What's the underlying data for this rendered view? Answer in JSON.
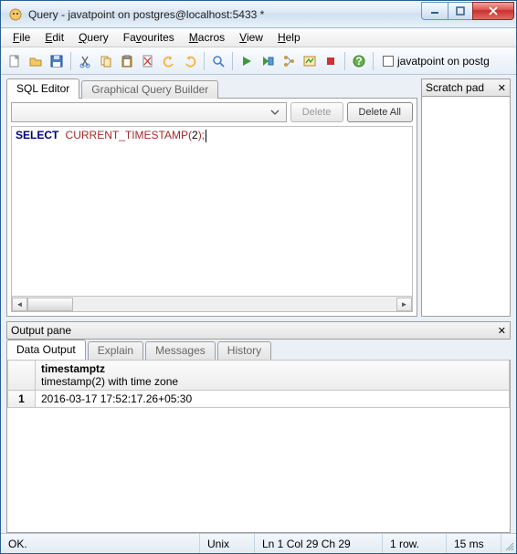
{
  "title": "Query - javatpoint on postgres@localhost:5433 *",
  "menubar": [
    "File",
    "Edit",
    "Query",
    "Favourites",
    "Macros",
    "View",
    "Help"
  ],
  "toolbar_label": "javatpoint on postg",
  "tabs": {
    "sql_editor": "SQL Editor",
    "graphical": "Graphical Query Builder"
  },
  "buttons": {
    "delete": "Delete",
    "delete_all": "Delete All"
  },
  "sql": {
    "kw": "SELECT",
    "fn": "CURRENT_TIMESTAMP",
    "open": "(",
    "arg": "2",
    "close": ");"
  },
  "scratch": {
    "title": "Scratch pad"
  },
  "output": {
    "title": "Output pane",
    "tabs": [
      "Data Output",
      "Explain",
      "Messages",
      "History"
    ],
    "col_name": "timestamptz",
    "col_type": "timestamp(2) with time zone",
    "row_num": "1",
    "cell": "2016-03-17 17:52:17.26+05:30"
  },
  "status": {
    "ok": "OK.",
    "enc": "Unix",
    "pos": "Ln 1 Col 29 Ch 29",
    "rows": "1 row.",
    "time": "15 ms"
  }
}
